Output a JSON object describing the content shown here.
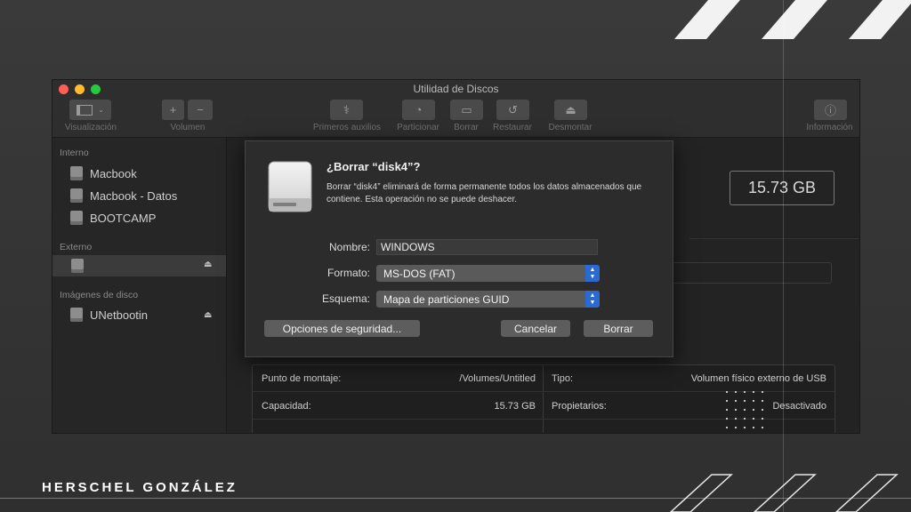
{
  "brand": "HERSCHEL GONZÁLEZ",
  "window": {
    "title": "Utilidad de Discos",
    "toolbar": {
      "view_label": "Visualización",
      "volume_label": "Volumen",
      "plus": "+",
      "minus": "−",
      "first_aid_label": "Primeros auxilios",
      "partition_label": "Particionar",
      "erase_label": "Borrar",
      "restore_label": "Restaurar",
      "unmount_label": "Desmontar",
      "info_label": "Información"
    },
    "sidebar": {
      "internal_header": "Interno",
      "internal_items": [
        "Macbook",
        "Macbook - Datos",
        "BOOTCAMP"
      ],
      "external_header": "Externo",
      "disk_images_header": "Imágenes de disco",
      "disk_image_item": "UNetbootin",
      "eject": "⏏"
    },
    "main": {
      "capacity_box": "15.73 GB",
      "info": {
        "mount_point_label": "Punto de montaje:",
        "mount_point_value": "/Volumes/Untitled",
        "capacity_label": "Capacidad:",
        "capacity_value": "15.73 GB",
        "type_label": "Tipo:",
        "type_value": "Volumen físico externo de USB",
        "owners_label": "Propietarios:",
        "owners_value": "Desactivado"
      }
    }
  },
  "dialog": {
    "title": "¿Borrar “disk4”?",
    "message": "Borrar “disk4” eliminará de forma permanente todos los datos almacenados que contiene. Esta operación no se puede deshacer.",
    "name_label": "Nombre:",
    "name_value": "WINDOWS",
    "format_label": "Formato:",
    "format_value": "MS-DOS (FAT)",
    "scheme_label": "Esquema:",
    "scheme_value": "Mapa de particiones GUID",
    "security_button": "Opciones de seguridad...",
    "cancel_button": "Cancelar",
    "erase_button": "Borrar"
  },
  "colors": {
    "close": "#ff5f57",
    "minimize": "#febc2e",
    "zoom": "#28c840",
    "popup_accent": "#2b6ad0"
  }
}
